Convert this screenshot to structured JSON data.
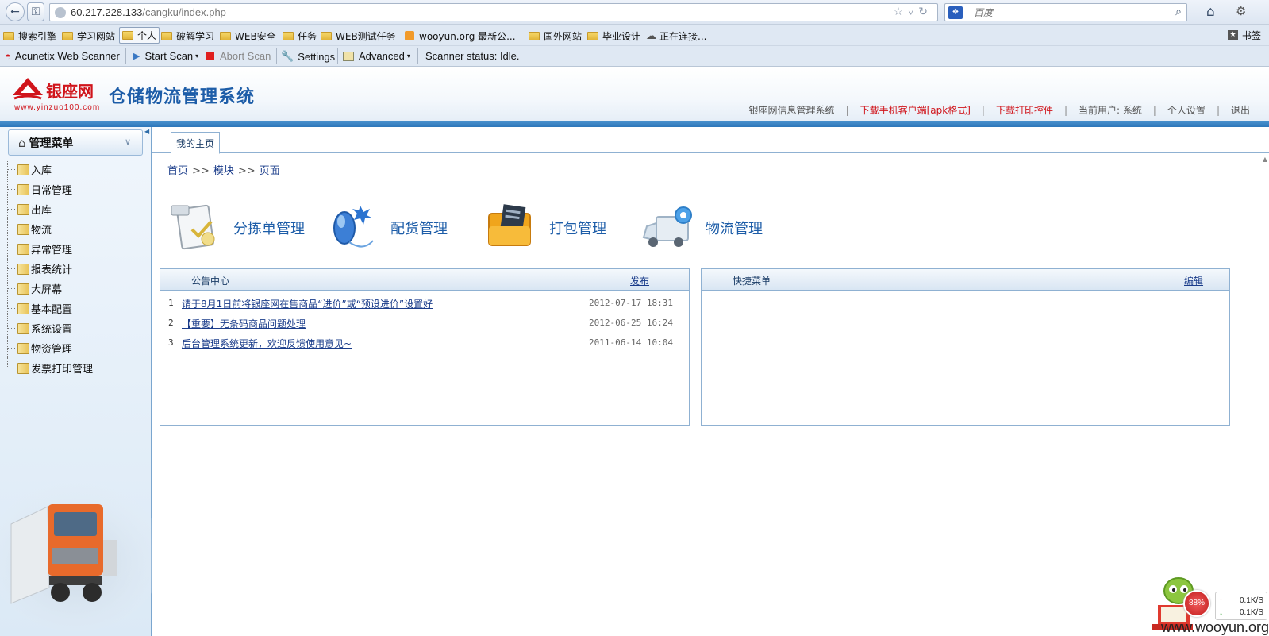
{
  "browser": {
    "url_host": "60.217.228.133",
    "url_path": "/cangku/index.php",
    "search_placeholder": "百度",
    "bookmarks": [
      {
        "label": "搜索引擎",
        "type": "folder"
      },
      {
        "label": "学习网站",
        "type": "folder"
      },
      {
        "label": "个人",
        "type": "folder"
      },
      {
        "label": "破解学习",
        "type": "folder"
      },
      {
        "label": "WEB安全",
        "type": "folder"
      },
      {
        "label": "任务",
        "type": "folder"
      },
      {
        "label": "WEB测试任务",
        "type": "folder"
      },
      {
        "label": "wooyun.org 最新公...",
        "type": "rss"
      },
      {
        "label": "国外网站",
        "type": "folder"
      },
      {
        "label": "毕业设计",
        "type": "folder"
      },
      {
        "label": "正在连接...",
        "type": "loading"
      }
    ],
    "bookmarks_menu": "书签"
  },
  "scanner_toolbar": {
    "product": "Acunetix Web Scanner",
    "start_scan": "Start Scan",
    "abort_scan": "Abort Scan",
    "settings": "Settings",
    "advanced": "Advanced",
    "status": "Scanner status: Idle."
  },
  "app": {
    "logo_name": "银座网",
    "logo_domain": "www.yinzuo100.com",
    "system_title": "仓储物流管理系统",
    "header_links": {
      "info_system": "银座网信息管理系统",
      "download_apk": "下载手机客户端[apk格式]",
      "download_print": "下载打印控件",
      "current_user": "当前用户: 系统",
      "personal_settings": "个人设置",
      "logout": "退出"
    },
    "accent_color": "#2d77ba",
    "link_red": "#d0141b"
  },
  "sidebar": {
    "title": "管理菜单",
    "items": [
      "入库",
      "日常管理",
      "出库",
      "物流",
      "异常管理",
      "报表统计",
      "大屏幕",
      "基本配置",
      "系统设置",
      "物资管理",
      "发票打印管理"
    ]
  },
  "main": {
    "tab_label": "我的主页",
    "breadcrumb": [
      "首页",
      "模块",
      "页面"
    ],
    "breadcrumb_sep": ">>",
    "modules": [
      "分拣单管理",
      "配货管理",
      "打包管理",
      "物流管理"
    ],
    "notice_panel": {
      "title": "公告中心",
      "action": "发布",
      "items": [
        {
          "num": "1",
          "title": "请于8月1日前将银座网在售商品“进价”或“预设进价”设置好",
          "date": "2012-07-17 18:31"
        },
        {
          "num": "2",
          "title": "【重要】无条码商品问题处理",
          "date": "2012-06-25 16:24"
        },
        {
          "num": "3",
          "title": "后台管理系统更新，欢迎反馈使用意见~",
          "date": "2011-06-14 10:04"
        }
      ]
    },
    "quick_panel": {
      "title": "快捷菜单",
      "action": "编辑"
    }
  },
  "overlay": {
    "cpu": "88%",
    "upload": "0.1K/S",
    "download": "0.1K/S",
    "watermark": "www.wooyun.org"
  }
}
